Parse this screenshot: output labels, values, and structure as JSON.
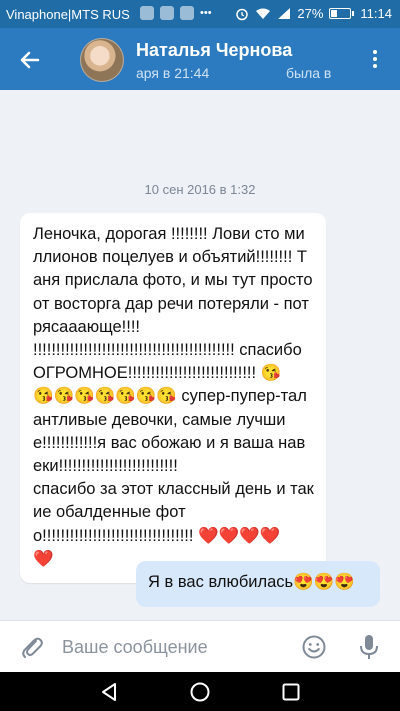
{
  "status_bar": {
    "carrier": "Vinaphone|MTS RUS",
    "battery": "27%",
    "time": "11:14"
  },
  "header": {
    "contact_name": "Наталья Чернова",
    "status_part1": "аря в 21:44",
    "status_part2": "была в"
  },
  "conversation": {
    "date_separator": "10 сен 2016 в 1:32",
    "incoming_text": "Леночка, дорогая !!!!!!!! Лови сто миллионов поцелуев и объятий!!!!!!!! Таня прислала фото, и мы тут просто от восторга дар речи потеряли - потрясааающе!!!! !!!!!!!!!!!!!!!!!!!!!!!!!!!!!!!!!!!!!!!!!!!! спасибо ОГРОМНОЕ!!!!!!!!!!!!!!!!!!!!!!!!!!!! 😘\n😘😘😘😘😘😘😘 супер-пупер-талантливые девочки, самые лучшие!!!!!!!!!!!!я вас обожаю и я ваша навеки!!!!!!!!!!!!!!!!!!!!!!!!!!\nспасибо за этот классный день и такие обалденные фото!!!!!!!!!!!!!!!!!!!!!!!!!!!!!!!!! ❤️❤️❤️❤️\n❤️",
    "outgoing_text": "Я в вас влюбилась😍😍😍"
  },
  "composer": {
    "placeholder": "Ваше сообщение"
  },
  "colors": {
    "status_bar": "#1f6ca6",
    "header": "#2c7bc0",
    "chat_background": "#eef1f5",
    "outgoing_bubble": "#d7e8fa"
  },
  "icons": {
    "header": [
      "back-arrow-icon",
      "more-vertical-icon"
    ],
    "composer": [
      "paperclip-icon",
      "emoji-icon",
      "microphone-icon"
    ],
    "navigation": [
      "nav-back-icon",
      "nav-home-icon",
      "nav-recent-icon"
    ]
  }
}
